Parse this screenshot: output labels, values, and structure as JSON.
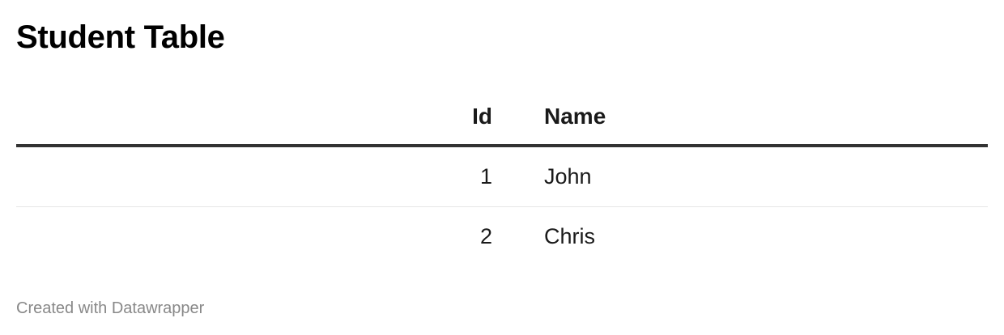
{
  "chart_data": {
    "type": "table",
    "title": "Student Table",
    "columns": [
      "Id",
      "Name"
    ],
    "rows": [
      [
        "1",
        "John"
      ],
      [
        "2",
        "Chris"
      ]
    ]
  },
  "footer": {
    "credit": "Created with Datawrapper"
  },
  "colors": {
    "header_rule": "#333333",
    "row_divider": "#e6e6e6",
    "footer_text": "#888888"
  }
}
